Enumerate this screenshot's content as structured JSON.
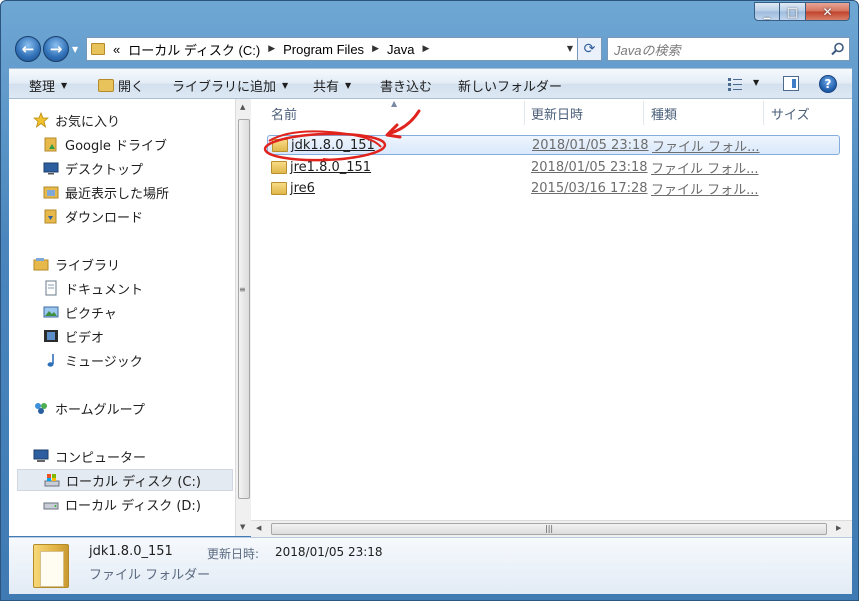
{
  "address_bar": {
    "prefix": "«",
    "crumbs": [
      "ローカル ディスク (C:)",
      "Program Files",
      "Java"
    ]
  },
  "search": {
    "placeholder": "Javaの検索"
  },
  "command_bar": {
    "organize": "整理",
    "open": "開く",
    "add_to_library": "ライブラリに追加",
    "share": "共有",
    "burn": "書き込む",
    "new_folder": "新しいフォルダー"
  },
  "nav_pane": {
    "favorites": "お気に入り",
    "google_drive": "Google ドライブ",
    "desktop": "デスクトップ",
    "recent": "最近表示した場所",
    "downloads": "ダウンロード",
    "libraries": "ライブラリ",
    "documents": "ドキュメント",
    "pictures": "ピクチャ",
    "videos": "ビデオ",
    "music": "ミュージック",
    "homegroup": "ホームグループ",
    "computer": "コンピューター",
    "drive_c": "ローカル ディスク (C:)",
    "drive_d": "ローカル ディスク (D:)"
  },
  "columns": {
    "name": "名前",
    "modified": "更新日時",
    "type": "種類",
    "size": "サイズ"
  },
  "files": [
    {
      "name": "jdk1.8.0_151",
      "modified": "2018/01/05 23:18",
      "type": "ファイル フォル..."
    },
    {
      "name": "jre1.8.0_151",
      "modified": "2018/01/05 23:18",
      "type": "ファイル フォル..."
    },
    {
      "name": "jre6",
      "modified": "2015/03/16 17:28",
      "type": "ファイル フォル..."
    }
  ],
  "details": {
    "name": "jdk1.8.0_151",
    "modified_label": "更新日時:",
    "modified": "2018/01/05 23:18",
    "type": "ファイル フォルダー"
  },
  "colors": {
    "accent": "#3d7cc6",
    "annotation": "#e0231c",
    "selection": "#d9e8fb"
  }
}
